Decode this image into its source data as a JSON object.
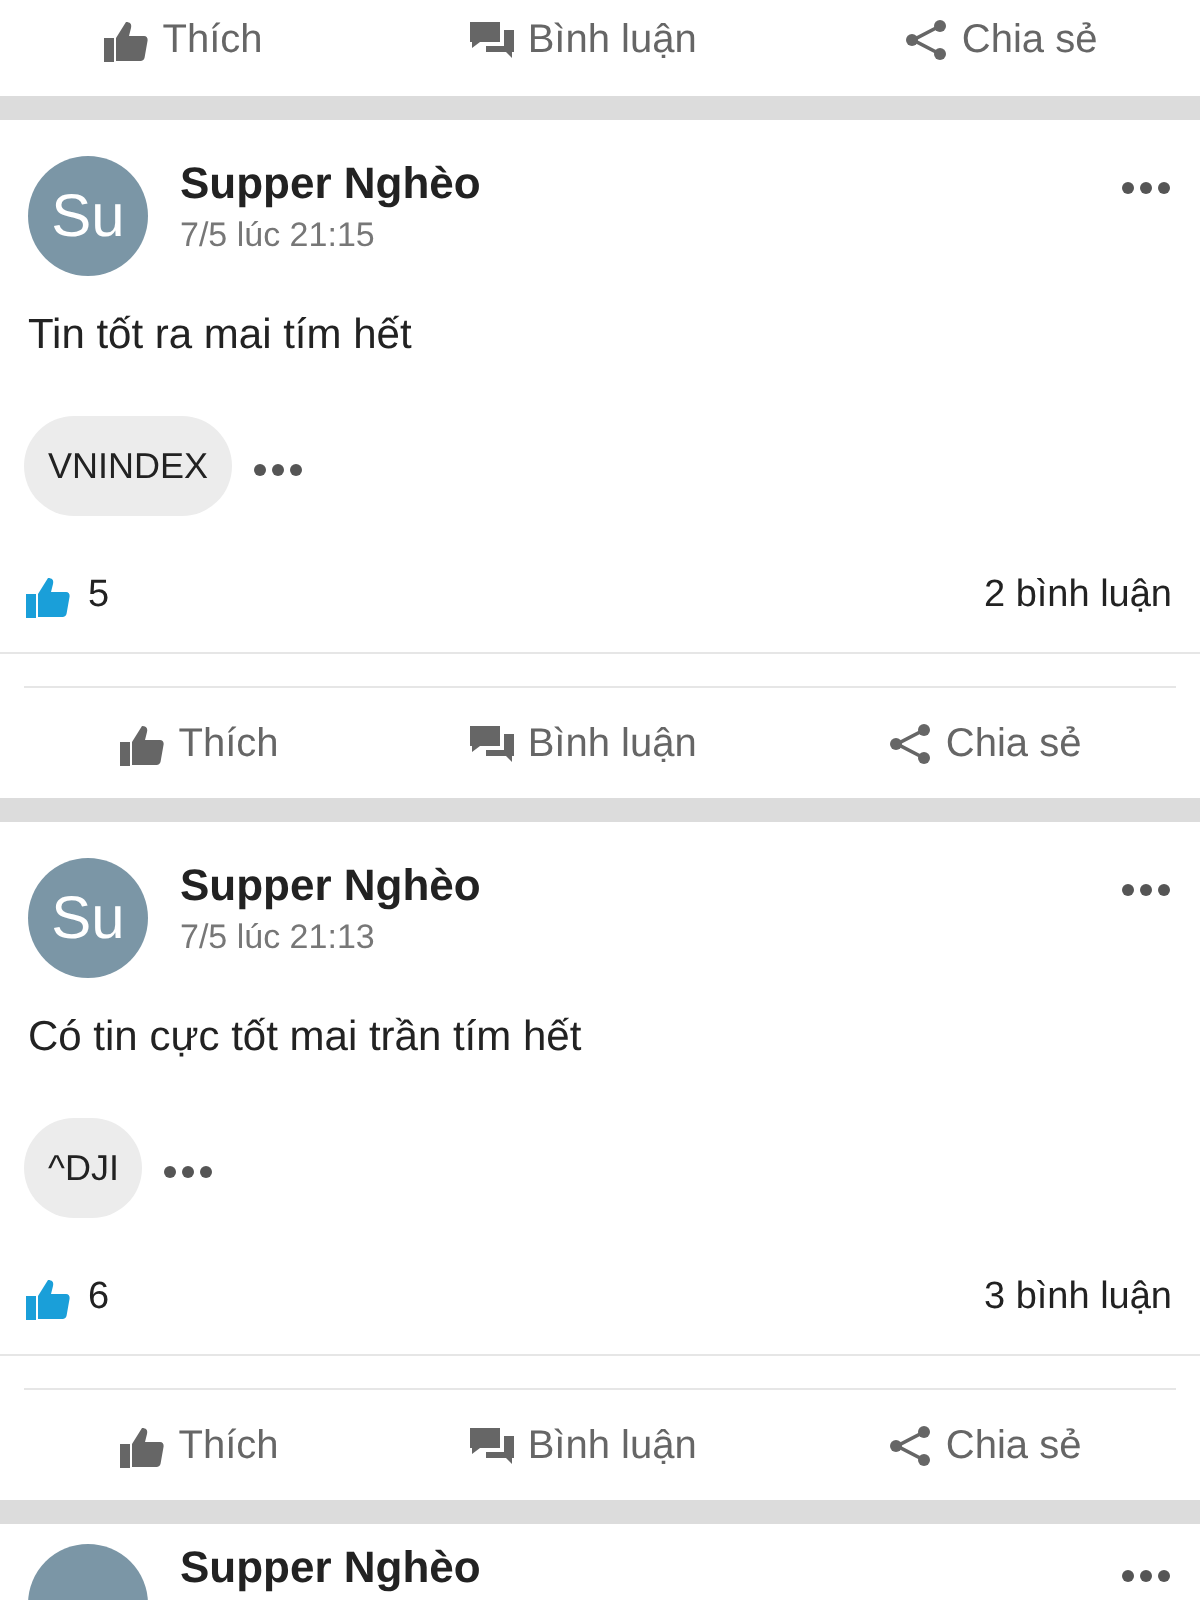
{
  "top_actions": [
    {
      "kind": "like",
      "label": "Thích"
    },
    {
      "kind": "comment",
      "label": "Bình luận"
    },
    {
      "kind": "share",
      "label": "Chia sẻ"
    }
  ],
  "posts": [
    {
      "avatar": "Su",
      "author": "Supper Nghèo",
      "time": "7/5 lúc 21:15",
      "text": "Tin tốt ra mai tím hết",
      "tag": "VNINDEX",
      "likes": "5",
      "comments": "2 bình luận",
      "actions": [
        {
          "kind": "like",
          "label": "Thích"
        },
        {
          "kind": "comment",
          "label": "Bình luận"
        },
        {
          "kind": "share",
          "label": "Chia sẻ"
        }
      ]
    },
    {
      "avatar": "Su",
      "author": "Supper Nghèo",
      "time": "7/5 lúc 21:13",
      "text": "Có tin cực tốt mai trần tím hết",
      "tag": "^DJI",
      "likes": "6",
      "comments": "3 bình luận",
      "actions": [
        {
          "kind": "like",
          "label": "Thích"
        },
        {
          "kind": "comment",
          "label": "Bình luận"
        },
        {
          "kind": "share",
          "label": "Chia sẻ"
        }
      ]
    }
  ],
  "partial_post": {
    "author": "Supper Nghèo"
  }
}
